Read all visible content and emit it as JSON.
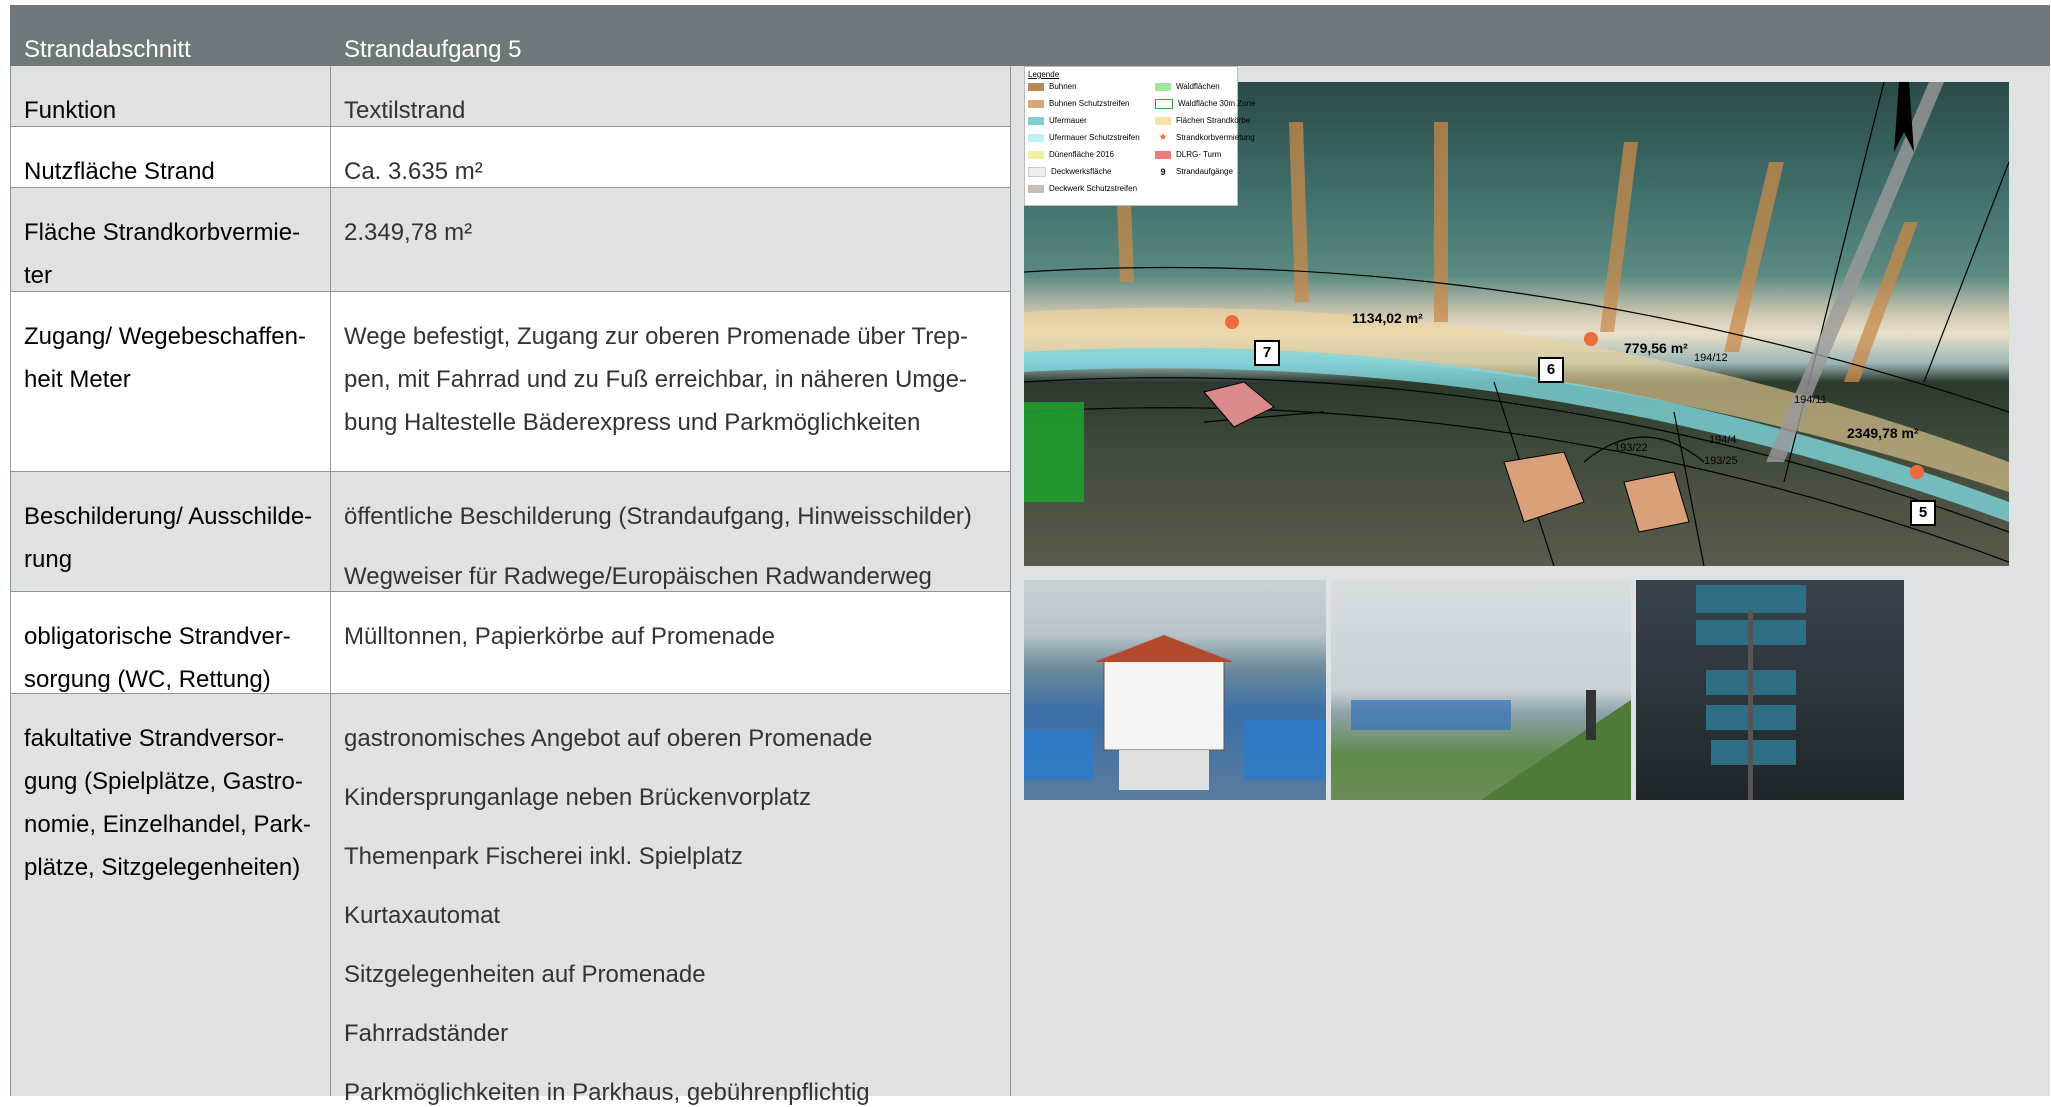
{
  "header": {
    "col1": "Strandabschnitt",
    "col2": "Strandaufgang 5"
  },
  "rows": [
    {
      "label": "Funktion",
      "value": "Textilstrand"
    },
    {
      "label": "Nutzfläche Strand",
      "value": "Ca. 3.635 m²"
    },
    {
      "label": "Fläche Strandkorbvermie-ter",
      "value": "2.349,78 m²"
    },
    {
      "label": "Zugang/ Wegebeschaffen-heit Meter",
      "value": "Wege befestigt, Zugang zur oberen Promenade über Trep-pen, mit Fahrrad und zu Fuß erreichbar, in näheren Umge-bung Haltestelle Bäderexpress und Parkmöglichkeiten"
    },
    {
      "label": "Beschilderung/ Ausschilde-rung",
      "items": [
        "öffentliche Beschilderung (Strandaufgang, Hinweisschilder)",
        "Wegweiser für Radwege/Europäischen Radwanderweg"
      ]
    },
    {
      "label": "obligatorische Strandver-sorgung (WC, Rettung)",
      "value": "Mülltonnen, Papierkörbe auf Promenade"
    },
    {
      "label": "fakultative Strandversor-gung (Spielplätze, Gastro-nomie, Einzelhandel, Park-plätze, Sitzgelegenheiten)",
      "items": [
        "gastronomisches Angebot auf oberen Promenade",
        "Kindersprunganlage neben Brückenvorplatz",
        "Themenpark Fischerei inkl. Spielplatz",
        "Kurtaxautomat",
        "Sitzgelegenheiten auf Promenade",
        "Fahrradständer",
        "Parkmöglichkeiten in Parkhaus, gebührenpflichtig"
      ]
    }
  ],
  "map": {
    "legend_title": "Legende",
    "legend": [
      {
        "label": "Buhnen",
        "color": "#b5895a"
      },
      {
        "label": "Buhnen Schutzstreifen",
        "color": "#d9a57a"
      },
      {
        "label": "Ufermauer",
        "color": "#7ecfd2"
      },
      {
        "label": "Ufermauer Schutzstreifen",
        "color": "#bff0f5"
      },
      {
        "label": "Dünenfläche 2016",
        "color": "#eef2a0"
      },
      {
        "label": "Deckwerksfläche",
        "color": "#eeeeea"
      },
      {
        "label": "Deckwerk Schutzstreifen",
        "color": "#c7bfae"
      },
      {
        "label": "Waldflächen",
        "color": "#9ee69e"
      },
      {
        "label": "Waldfläche 30m Zone",
        "color": "#ffffff"
      },
      {
        "label": "Flächen Strandkörbe",
        "color": "#f8e1a6"
      },
      {
        "label": "Strandkorbvermietung",
        "color": "#ee6b3b"
      },
      {
        "label": "DLRG- Turm",
        "color": "#f07a7a"
      },
      {
        "label": "Strandaufgänge",
        "color": "#000000"
      }
    ],
    "strandaufgang_symbol": "9",
    "areas": [
      "1134,02 m²",
      "779,56 m²",
      "2349,78 m²"
    ],
    "entrances": [
      "7",
      "6",
      "5"
    ],
    "parcels": [
      "194/12",
      "194/11",
      "194/4",
      "193/22",
      "193/25"
    ]
  },
  "photos": [
    {
      "name": "lifeguard-tower-photo"
    },
    {
      "name": "promenade-beach-photo"
    },
    {
      "name": "signpost-photo"
    }
  ]
}
